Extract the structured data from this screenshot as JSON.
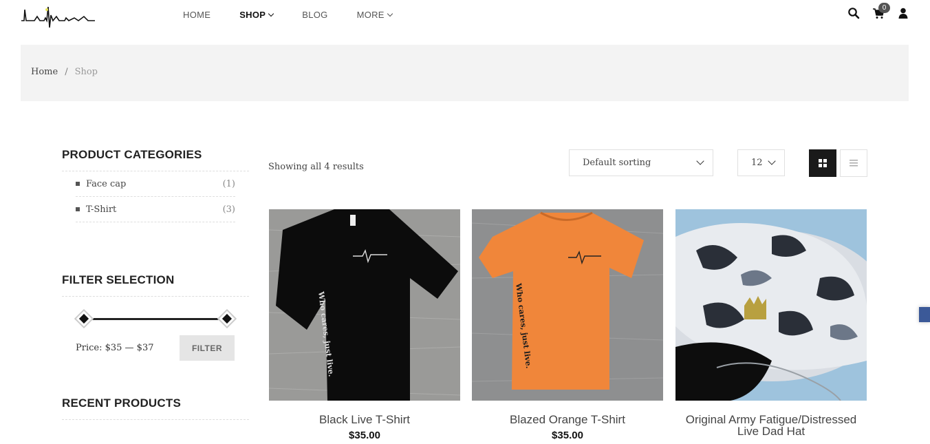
{
  "nav": {
    "items": [
      {
        "label": "HOME",
        "active": false,
        "has_dropdown": false
      },
      {
        "label": "SHOP",
        "active": true,
        "has_dropdown": true
      },
      {
        "label": "BLOG",
        "active": false,
        "has_dropdown": false
      },
      {
        "label": "MORE",
        "active": false,
        "has_dropdown": true
      }
    ],
    "cart_count": "0",
    "icons": [
      "search-icon",
      "cart-icon",
      "user-icon"
    ]
  },
  "breadcrumb": {
    "home": "Home",
    "separator": "/",
    "current": "Shop"
  },
  "sidebar": {
    "categories_title": "PRODUCT CATEGORIES",
    "categories": [
      {
        "name": "Face cap",
        "count": "(1)"
      },
      {
        "name": "T-Shirt",
        "count": "(3)"
      }
    ],
    "filter_title": "FILTER SELECTION",
    "price_text": "Price: $35 — $37",
    "filter_button": "FILTER",
    "recent_title": "RECENT PRODUCTS"
  },
  "toolbar": {
    "result_count": "Showing all 4 results",
    "sort_value": "Default sorting",
    "per_page_value": "12",
    "view_mode": "grid"
  },
  "products": [
    {
      "name": "Black Live T-Shirt",
      "price": "$35.00"
    },
    {
      "name": "Blazed Orange T-Shirt",
      "price": "$35.00"
    },
    {
      "name": "Original Army Fatigue/Distressed Live Dad Hat",
      "price": ""
    }
  ],
  "colors": {
    "accent": "#1a1a1a",
    "band": "#f3f3f3",
    "tshirt_orange": "#f08a3c"
  }
}
